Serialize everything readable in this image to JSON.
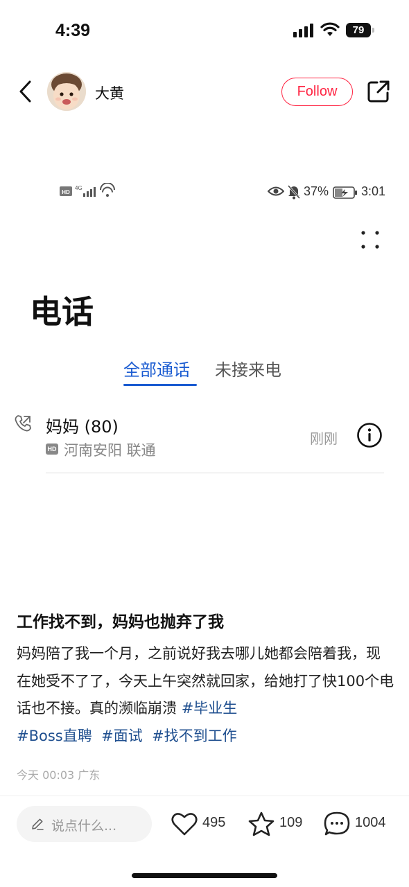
{
  "status_bar": {
    "time": "4:39",
    "battery": "79"
  },
  "header": {
    "author": "大黄",
    "follow_label": "Follow",
    "avatar_icon": "baby-avatar",
    "back_icon": "chevron-left-icon",
    "share_icon": "share-icon"
  },
  "inner_screenshot": {
    "status": {
      "net": "4G",
      "battery_pct": "37%",
      "time": "3:01"
    },
    "title": "电话",
    "tabs": [
      {
        "label": "全部通话",
        "active": true
      },
      {
        "label": "未接来电",
        "active": false
      }
    ],
    "call": {
      "name": "妈妈 (80)",
      "location": "河南安阳 联通",
      "time": "刚刚",
      "hd": "HD"
    }
  },
  "post": {
    "title": "工作找不到，妈妈也抛弃了我",
    "body_text": "妈妈陪了我一个月，之前说好我去哪儿她都会陪着我，现在她受不了了，今天上午突然就回家，给她打了快100个电话也不接。真的濒临崩溃 ",
    "tags": [
      "#毕业生",
      "#Boss直聘",
      "#面试",
      "#找不到工作"
    ],
    "meta": "今天 00:03 广东"
  },
  "bottom_bar": {
    "comment_placeholder": "说点什么...",
    "likes": "495",
    "collects": "109",
    "comments": "1004"
  },
  "colors": {
    "accent": "#ff2442",
    "link": "#1f4f8f",
    "tab_active": "#1a5bd1"
  }
}
